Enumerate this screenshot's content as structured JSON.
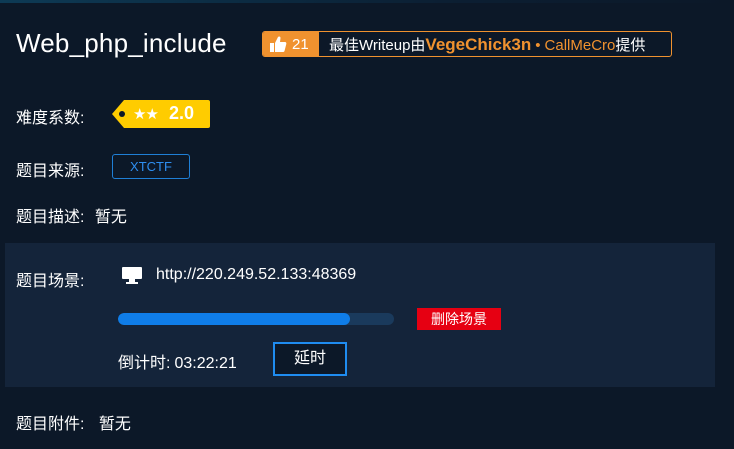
{
  "challenge": {
    "title": "Web_php_include"
  },
  "writeup": {
    "like_count": "21",
    "prefix": "最佳Writeup由",
    "author1": "VegeChick3n",
    "separator": "•",
    "author2": "CallMeCro",
    "suffix": "提供",
    "accent_color": "#f0922f"
  },
  "difficulty": {
    "label": "难度系数:",
    "stars": "★★",
    "value": "2.0",
    "tag_color": "#ffcc00"
  },
  "source": {
    "label": "题目来源:",
    "value": "XTCTF"
  },
  "description": {
    "label": "题目描述:",
    "value": "暂无"
  },
  "scene": {
    "label": "题目场景:",
    "icon": "monitor-icon",
    "url": "http://220.249.52.133:48369",
    "progress_percent": 84,
    "delete_label": "删除场景",
    "countdown_label": "倒计时:",
    "countdown_value": "03:22:21",
    "extend_label": "延时"
  },
  "attachment": {
    "label": "题目附件:",
    "value": "暂无"
  },
  "colors": {
    "background": "#0c1828",
    "panel": "#14243a",
    "primary_blue": "#0f7de8",
    "danger_red": "#e60012"
  }
}
